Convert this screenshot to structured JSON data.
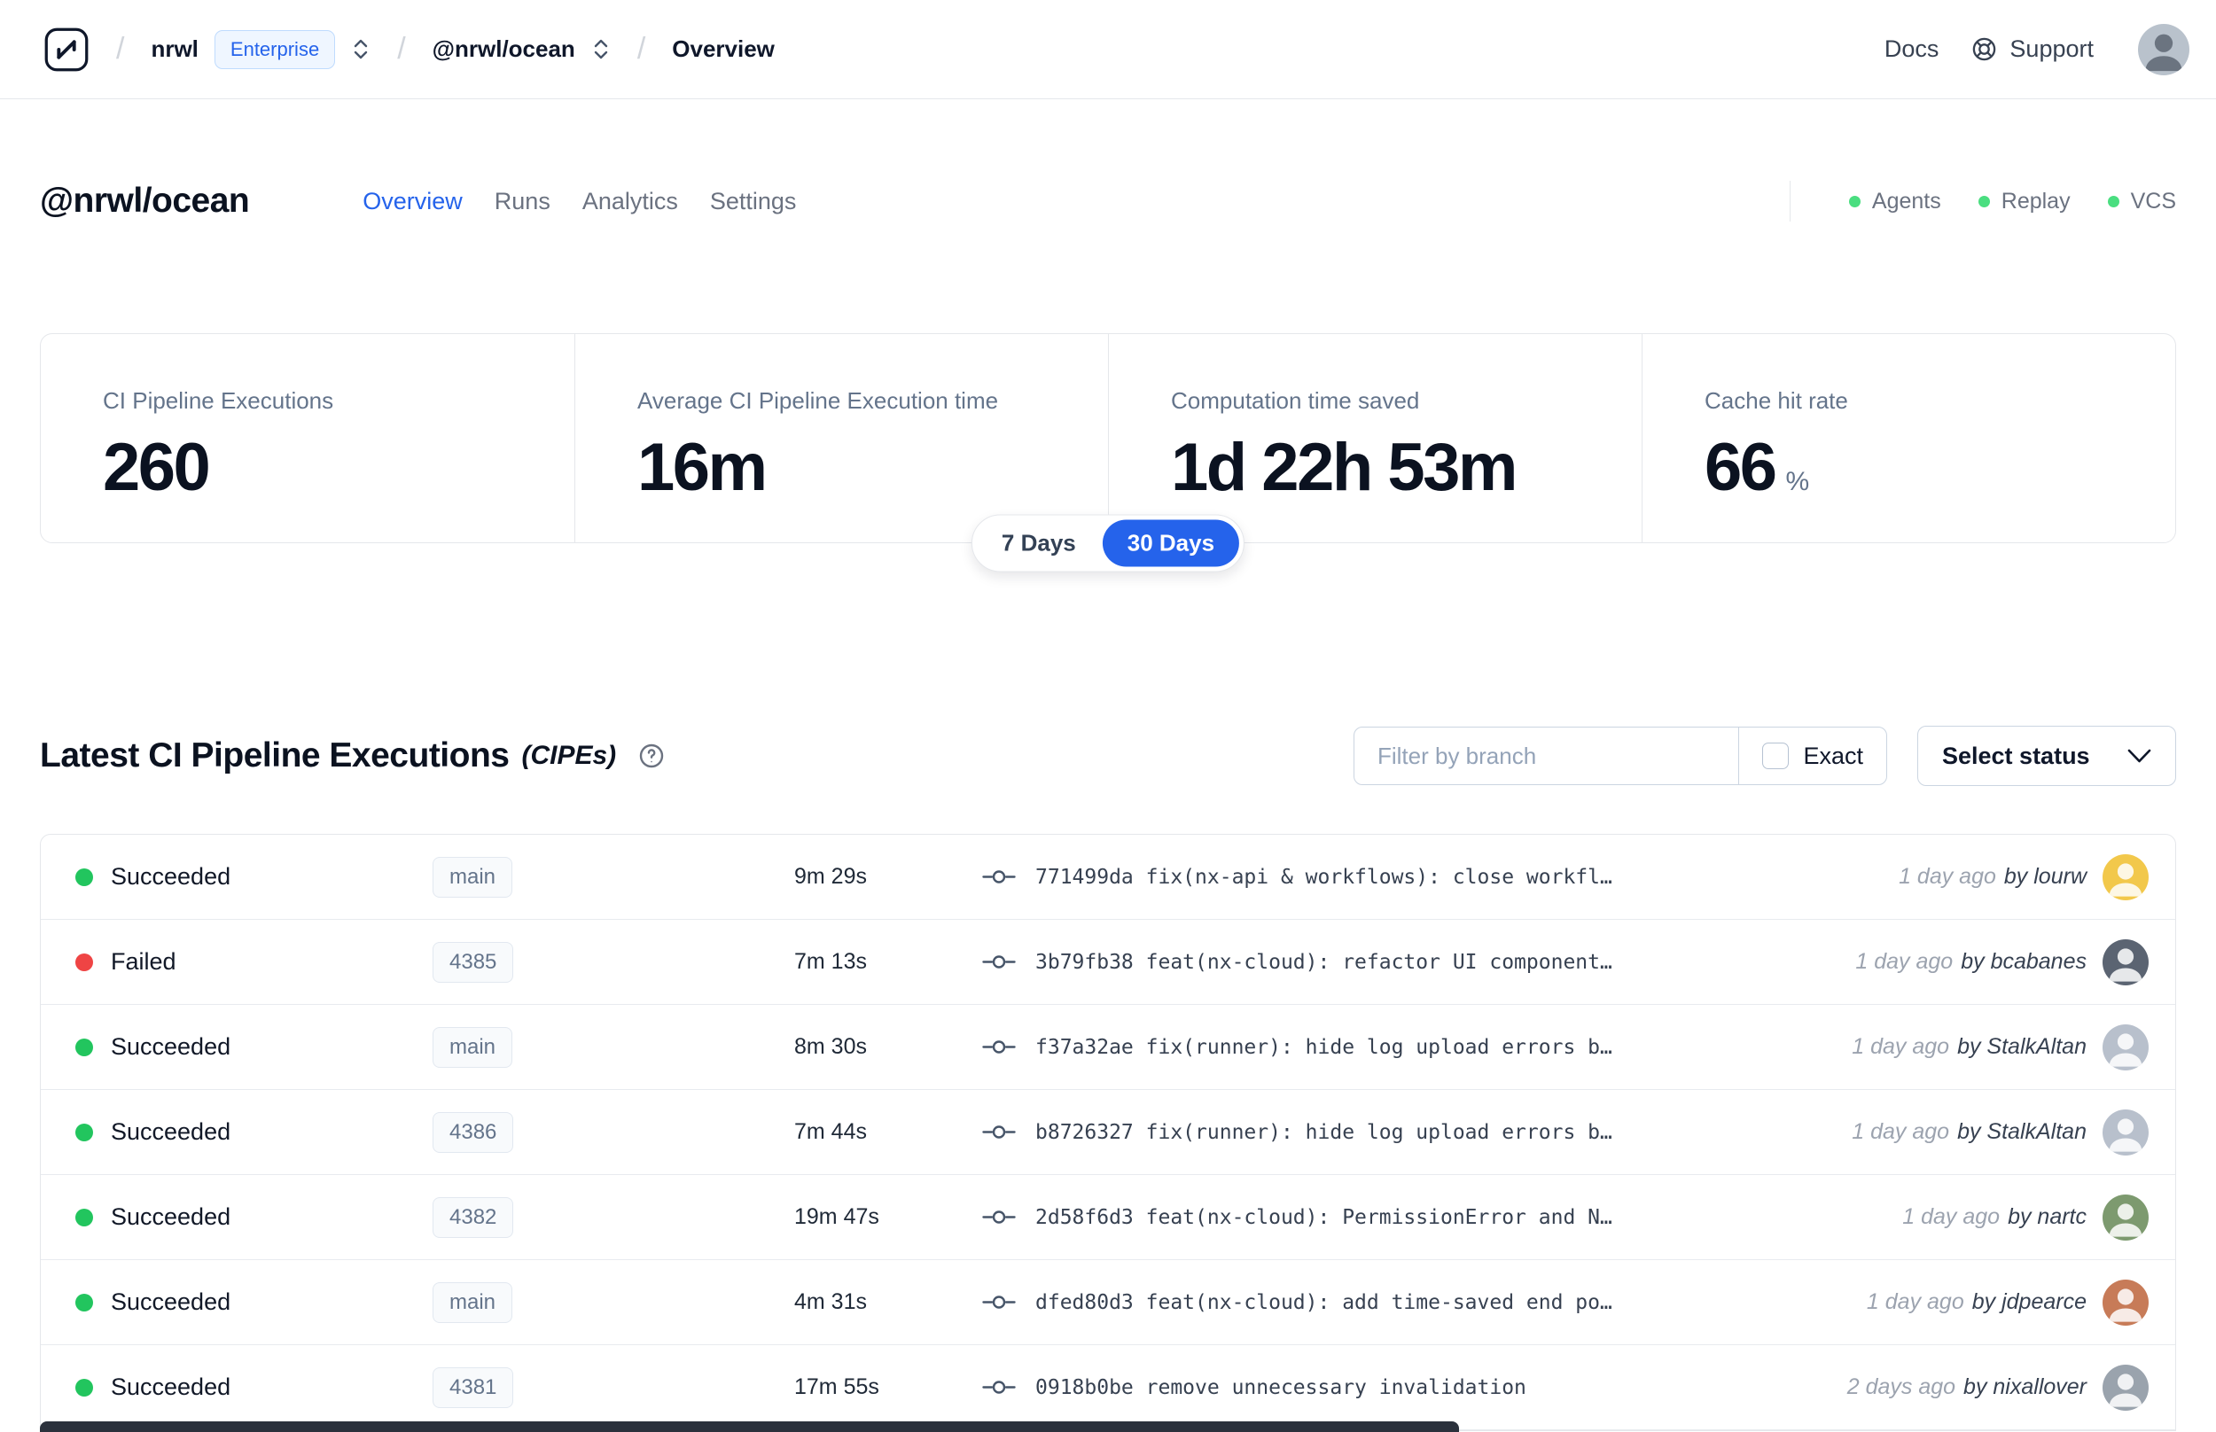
{
  "theme": {
    "accent": "#2563eb",
    "success": "#22c55e",
    "danger": "#ef4444"
  },
  "navbar": {
    "org": "nrwl",
    "org_badge": "Enterprise",
    "workspace": "@nrwl/ocean",
    "page": "Overview",
    "docs_label": "Docs",
    "support_label": "Support"
  },
  "header": {
    "title": "@nrwl/ocean",
    "tabs": [
      {
        "label": "Overview",
        "active": true
      },
      {
        "label": "Runs",
        "active": false
      },
      {
        "label": "Analytics",
        "active": false
      },
      {
        "label": "Settings",
        "active": false
      }
    ],
    "legend": [
      {
        "label": "Agents"
      },
      {
        "label": "Replay"
      },
      {
        "label": "VCS"
      }
    ]
  },
  "stats": {
    "cards": [
      {
        "label": "CI Pipeline Executions",
        "value": "260",
        "suffix": ""
      },
      {
        "label": "Average CI Pipeline Execution time",
        "value": "16m",
        "suffix": ""
      },
      {
        "label": "Computation time saved",
        "value": "1d 22h 53m",
        "suffix": ""
      },
      {
        "label": "Cache hit rate",
        "value": "66",
        "suffix": "%"
      }
    ],
    "range_options": [
      {
        "label": "7 Days",
        "active": false
      },
      {
        "label": "30 Days",
        "active": true
      }
    ]
  },
  "cipe": {
    "title": "Latest CI Pipeline Executions",
    "subtitle": "(CIPEs)",
    "filter_placeholder": "Filter by branch",
    "exact_label": "Exact",
    "status_select_label": "Select status"
  },
  "table": {
    "rows": [
      {
        "status": "Succeeded",
        "status_color": "#22c55e",
        "branch": "main",
        "duration": "9m 29s",
        "commit_hash": "771499da",
        "commit_message": "fix(nx-api & workflows): close workfl…",
        "time": "1 day ago",
        "author": "by lourw",
        "avatar_color": "#f2c84b"
      },
      {
        "status": "Failed",
        "status_color": "#ef4444",
        "branch": "4385",
        "duration": "7m 13s",
        "commit_hash": "3b79fb38",
        "commit_message": "feat(nx-cloud): refactor UI component…",
        "time": "1 day ago",
        "author": "by bcabanes",
        "avatar_color": "#5b6472"
      },
      {
        "status": "Succeeded",
        "status_color": "#22c55e",
        "branch": "main",
        "duration": "8m 30s",
        "commit_hash": "f37a32ae",
        "commit_message": "fix(runner): hide log upload errors b…",
        "time": "1 day ago",
        "author": "by StalkAltan",
        "avatar_color": "#b8c0cc"
      },
      {
        "status": "Succeeded",
        "status_color": "#22c55e",
        "branch": "4386",
        "duration": "7m 44s",
        "commit_hash": "b8726327",
        "commit_message": "fix(runner): hide log upload errors b…",
        "time": "1 day ago",
        "author": "by StalkAltan",
        "avatar_color": "#b8c0cc"
      },
      {
        "status": "Succeeded",
        "status_color": "#22c55e",
        "branch": "4382",
        "duration": "19m 47s",
        "commit_hash": "2d58f6d3",
        "commit_message": "feat(nx-cloud): PermissionError and N…",
        "time": "1 day ago",
        "author": "by nartc",
        "avatar_color": "#7d9a6f"
      },
      {
        "status": "Succeeded",
        "status_color": "#22c55e",
        "branch": "main",
        "duration": "4m 31s",
        "commit_hash": "dfed80d3",
        "commit_message": "feat(nx-cloud): add time-saved end po…",
        "time": "1 day ago",
        "author": "by jdpearce",
        "avatar_color": "#c77b58"
      },
      {
        "status": "Succeeded",
        "status_color": "#22c55e",
        "branch": "4381",
        "duration": "17m 55s",
        "commit_hash": "0918b0be",
        "commit_message": "remove unnecessary invalidation",
        "time": "2 days ago",
        "author": "by nixallover",
        "avatar_color": "#9aa3ad"
      }
    ]
  }
}
